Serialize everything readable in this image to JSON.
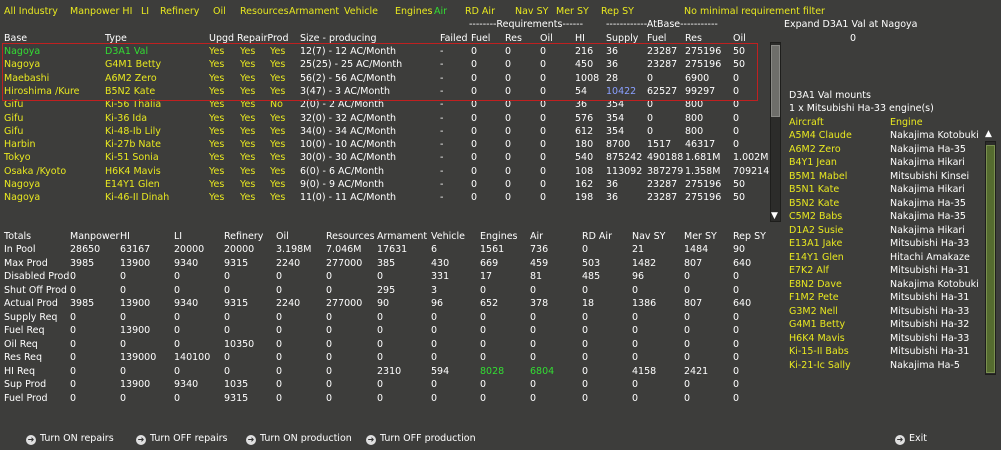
{
  "tabs": [
    {
      "label": "All Industry",
      "color": "yellow"
    },
    {
      "label": "Manpower HI",
      "color": "yellow"
    },
    {
      "label": "LI",
      "color": "yellow"
    },
    {
      "label": "Refinery",
      "color": "yellow"
    },
    {
      "label": "Oil",
      "color": "yellow"
    },
    {
      "label": "Resources",
      "color": "yellow"
    },
    {
      "label": "Armament",
      "color": "yellow"
    },
    {
      "label": "Vehicle",
      "color": "yellow"
    },
    {
      "label": "Engines",
      "color": "yellow"
    },
    {
      "label": "Air",
      "color": "green"
    },
    {
      "label": "RD Air",
      "color": "yellow"
    },
    {
      "label": "Nav SY",
      "color": "yellow"
    },
    {
      "label": "Mer SY",
      "color": "yellow"
    },
    {
      "label": "Rep SY",
      "color": "yellow"
    },
    {
      "label": "No minimal requirement filter",
      "color": "yellow"
    }
  ],
  "group_headers": {
    "requirements": "--------Requirements------",
    "atbase": "------------AtBase-----------"
  },
  "expand": {
    "title": "Expand D3A1 Val at Nagoya",
    "value": "0"
  },
  "industry_headers": [
    "Base",
    "Type",
    "Upgd",
    "RepairProd",
    "",
    "Size - producing",
    "Failed",
    "Fuel",
    "Res",
    "Oil",
    "HI",
    "Supply",
    "Fuel",
    "Res",
    "Oil"
  ],
  "industry_rows": [
    {
      "base": "Nagoya",
      "type": "D3A1 Val",
      "upgd": "Yes",
      "repair": "Yes",
      "prod": "Yes",
      "size": "12(7) - 12 AC/Month",
      "failed": "-",
      "fuel": "0",
      "res": "0",
      "oil": "0",
      "hi": "216",
      "supply": "36",
      "bfuel": "23287",
      "bres": "275196",
      "boil": "50",
      "color": "green",
      "supply_color": "white"
    },
    {
      "base": "Nagoya",
      "type": "G4M1 Betty",
      "upgd": "Yes",
      "repair": "Yes",
      "prod": "Yes",
      "size": "25(25) - 25 AC/Month",
      "failed": "-",
      "fuel": "0",
      "res": "0",
      "oil": "0",
      "hi": "450",
      "supply": "36",
      "bfuel": "23287",
      "bres": "275196",
      "boil": "50",
      "color": "yellow",
      "supply_color": "white"
    },
    {
      "base": "Maebashi",
      "type": "A6M2 Zero",
      "upgd": "Yes",
      "repair": "Yes",
      "prod": "Yes",
      "size": "56(2) - 56 AC/Month",
      "failed": "-",
      "fuel": "0",
      "res": "0",
      "oil": "0",
      "hi": "1008",
      "supply": "28",
      "bfuel": "0",
      "bres": "6900",
      "boil": "0",
      "color": "yellow",
      "supply_color": "white"
    },
    {
      "base": "Hiroshima /Kure",
      "type": "B5N2 Kate",
      "upgd": "Yes",
      "repair": "Yes",
      "prod": "Yes",
      "size": "3(47) - 3 AC/Month",
      "failed": "-",
      "fuel": "0",
      "res": "0",
      "oil": "0",
      "hi": "54",
      "supply": "10422",
      "bfuel": "62527",
      "bres": "99297",
      "boil": "0",
      "color": "yellow",
      "supply_color": "blue"
    },
    {
      "base": "Gifu",
      "type": "Ki-56 Thalia",
      "upgd": "Yes",
      "repair": "Yes",
      "prod": "No",
      "size": "2(0) - 2 AC/Month",
      "failed": "-",
      "fuel": "0",
      "res": "0",
      "oil": "0",
      "hi": "36",
      "supply": "354",
      "bfuel": "0",
      "bres": "800",
      "boil": "0",
      "color": "yellow",
      "supply_color": "white"
    },
    {
      "base": "Gifu",
      "type": "Ki-36 Ida",
      "upgd": "Yes",
      "repair": "Yes",
      "prod": "Yes",
      "size": "32(0) - 32 AC/Month",
      "failed": "-",
      "fuel": "0",
      "res": "0",
      "oil": "0",
      "hi": "576",
      "supply": "354",
      "bfuel": "0",
      "bres": "800",
      "boil": "0",
      "color": "yellow",
      "supply_color": "white"
    },
    {
      "base": "Gifu",
      "type": "Ki-48-Ib Lily",
      "upgd": "Yes",
      "repair": "Yes",
      "prod": "Yes",
      "size": "34(0) - 34 AC/Month",
      "failed": "-",
      "fuel": "0",
      "res": "0",
      "oil": "0",
      "hi": "612",
      "supply": "354",
      "bfuel": "0",
      "bres": "800",
      "boil": "0",
      "color": "yellow",
      "supply_color": "white"
    },
    {
      "base": "Harbin",
      "type": "Ki-27b Nate",
      "upgd": "Yes",
      "repair": "Yes",
      "prod": "Yes",
      "size": "10(0) - 10 AC/Month",
      "failed": "-",
      "fuel": "0",
      "res": "0",
      "oil": "0",
      "hi": "180",
      "supply": "8700",
      "bfuel": "1517",
      "bres": "46317",
      "boil": "0",
      "color": "yellow",
      "supply_color": "white"
    },
    {
      "base": "Tokyo",
      "type": "Ki-51 Sonia",
      "upgd": "Yes",
      "repair": "Yes",
      "prod": "Yes",
      "size": "30(0) - 30 AC/Month",
      "failed": "-",
      "fuel": "0",
      "res": "0",
      "oil": "0",
      "hi": "540",
      "supply": "875242",
      "bfuel": "490188",
      "bres": "1.681M",
      "boil": "1.002M",
      "color": "yellow",
      "supply_color": "white"
    },
    {
      "base": "Osaka /Kyoto",
      "type": "H6K4 Mavis",
      "upgd": "Yes",
      "repair": "Yes",
      "prod": "Yes",
      "size": "6(0) - 6 AC/Month",
      "failed": "-",
      "fuel": "0",
      "res": "0",
      "oil": "0",
      "hi": "108",
      "supply": "113092",
      "bfuel": "387279",
      "bres": "1.358M",
      "boil": "709214",
      "color": "yellow",
      "supply_color": "white"
    },
    {
      "base": "Nagoya",
      "type": "E14Y1 Glen",
      "upgd": "Yes",
      "repair": "Yes",
      "prod": "Yes",
      "size": "9(0) - 9 AC/Month",
      "failed": "-",
      "fuel": "0",
      "res": "0",
      "oil": "0",
      "hi": "162",
      "supply": "36",
      "bfuel": "23287",
      "bres": "275196",
      "boil": "50",
      "color": "yellow",
      "supply_color": "white"
    },
    {
      "base": "Nagoya",
      "type": "Ki-46-II Dinah",
      "upgd": "Yes",
      "repair": "Yes",
      "prod": "Yes",
      "size": "11(0) - 11 AC/Month",
      "failed": "-",
      "fuel": "0",
      "res": "0",
      "oil": "0",
      "hi": "198",
      "supply": "36",
      "bfuel": "23287",
      "bres": "275196",
      "boil": "50",
      "color": "yellow",
      "supply_color": "white"
    }
  ],
  "totals_headers": [
    "Totals",
    "Manpower",
    "HI",
    "LI",
    "Refinery",
    "Oil",
    "Resources",
    "Armament",
    "Vehicle",
    "Engines",
    "Air",
    "RD Air",
    "Nav SY",
    "Mer SY",
    "Rep SY"
  ],
  "totals_rows": [
    {
      "label": "In Pool",
      "values": [
        "28650",
        "63167",
        "20000",
        "20000",
        "3.198M",
        "7.046M",
        "17631",
        "6",
        "1561",
        "736",
        "0",
        "21",
        "1484",
        "90"
      ]
    },
    {
      "label": "Max Prod",
      "values": [
        "3985",
        "13900",
        "9340",
        "9315",
        "2240",
        "277000",
        "385",
        "430",
        "669",
        "459",
        "503",
        "1482",
        "807",
        "640"
      ]
    },
    {
      "label": "Disabled Prod",
      "values": [
        "0",
        "0",
        "0",
        "0",
        "0",
        "0",
        "0",
        "331",
        "17",
        "81",
        "485",
        "96",
        "0",
        "0"
      ]
    },
    {
      "label": "Shut Off Prod",
      "values": [
        "0",
        "0",
        "0",
        "0",
        "0",
        "0",
        "295",
        "3",
        "0",
        "0",
        "0",
        "0",
        "0",
        "0"
      ]
    },
    {
      "label": "Actual Prod",
      "values": [
        "3985",
        "13900",
        "9340",
        "9315",
        "2240",
        "277000",
        "90",
        "96",
        "652",
        "378",
        "18",
        "1386",
        "807",
        "640"
      ]
    },
    {
      "label": "Supply Req",
      "values": [
        "0",
        "0",
        "0",
        "0",
        "0",
        "0",
        "0",
        "0",
        "0",
        "0",
        "0",
        "0",
        "0",
        "0"
      ]
    },
    {
      "label": "Fuel Req",
      "values": [
        "0",
        "13900",
        "0",
        "0",
        "0",
        "0",
        "0",
        "0",
        "0",
        "0",
        "0",
        "0",
        "0",
        "0"
      ]
    },
    {
      "label": "Oil Req",
      "values": [
        "0",
        "0",
        "0",
        "10350",
        "0",
        "0",
        "0",
        "0",
        "0",
        "0",
        "0",
        "0",
        "0",
        "0"
      ]
    },
    {
      "label": "Res Req",
      "values": [
        "0",
        "139000",
        "140100",
        "0",
        "0",
        "0",
        "0",
        "0",
        "0",
        "0",
        "0",
        "0",
        "0",
        "0"
      ]
    },
    {
      "label": "HI Req",
      "values": [
        "0",
        "0",
        "0",
        "0",
        "0",
        "0",
        "2310",
        "594",
        "8028",
        "6804",
        "0",
        "4158",
        "2421",
        "0"
      ]
    },
    {
      "label": "Sup Prod",
      "values": [
        "0",
        "13900",
        "9340",
        "1035",
        "0",
        "0",
        "0",
        "0",
        "0",
        "0",
        "0",
        "0",
        "0",
        "0"
      ]
    },
    {
      "label": "Fuel Prod",
      "values": [
        "0",
        "0",
        "0",
        "9315",
        "0",
        "0",
        "0",
        "0",
        "0",
        "0",
        "0",
        "0",
        "0",
        "0"
      ]
    }
  ],
  "mounts": {
    "title": "D3A1 Val mounts",
    "engine_line": "1 x Mitsubishi Ha-33 engine(s)",
    "col_aircraft": "Aircraft",
    "col_engine": "Engine"
  },
  "aircraft_list": [
    {
      "aircraft": "A5M4 Claude",
      "engine": "Nakajima Kotobuki"
    },
    {
      "aircraft": "A6M2 Zero",
      "engine": "Nakajima Ha-35"
    },
    {
      "aircraft": "B4Y1 Jean",
      "engine": "Nakajima Hikari"
    },
    {
      "aircraft": "B5M1 Mabel",
      "engine": "Mitsubishi Kinsei"
    },
    {
      "aircraft": "B5N1 Kate",
      "engine": "Nakajima Hikari"
    },
    {
      "aircraft": "B5N2 Kate",
      "engine": "Nakajima Ha-35"
    },
    {
      "aircraft": "C5M2 Babs",
      "engine": "Nakajima Ha-35"
    },
    {
      "aircraft": "D1A2 Susie",
      "engine": "Nakajima Hikari"
    },
    {
      "aircraft": "E13A1 Jake",
      "engine": "Mitsubishi Ha-33"
    },
    {
      "aircraft": "E14Y1 Glen",
      "engine": "Hitachi Amakaze"
    },
    {
      "aircraft": "E7K2 Alf",
      "engine": "Mitsubishi Ha-31"
    },
    {
      "aircraft": "E8N2 Dave",
      "engine": "Nakajima Kotobuki"
    },
    {
      "aircraft": "F1M2 Pete",
      "engine": "Mitsubishi Ha-31"
    },
    {
      "aircraft": "G3M2 Nell",
      "engine": "Mitsubishi Ha-33"
    },
    {
      "aircraft": "G4M1 Betty",
      "engine": "Mitsubishi Ha-32"
    },
    {
      "aircraft": "H6K4 Mavis",
      "engine": "Mitsubishi Ha-33"
    },
    {
      "aircraft": "Ki-15-II Babs",
      "engine": "Mitsubishi Ha-31"
    },
    {
      "aircraft": "Ki-21-Ic Sally",
      "engine": "Nakajima Ha-5"
    }
  ],
  "buttons": {
    "repairs_on": "Turn ON repairs",
    "repairs_off": "Turn OFF repairs",
    "prod_on": "Turn ON production",
    "prod_off": "Turn OFF production",
    "exit": "Exit"
  },
  "colors": {
    "background": "#3d3d3b",
    "yellow": "#e8e820",
    "green": "#33dd33",
    "blue": "#8aa0ff",
    "red_box": "#c02020"
  }
}
